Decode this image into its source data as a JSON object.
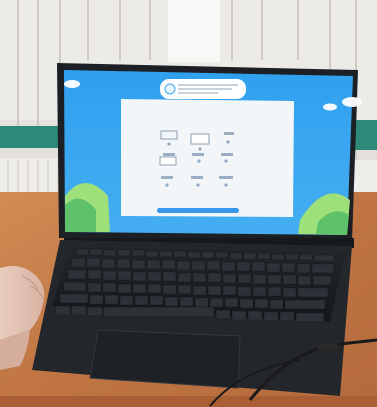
{
  "scene": {
    "subject": "laptop",
    "screen_app": {
      "grid_labels": [
        "",
        "",
        "",
        "",
        "",
        "",
        "",
        "",
        ""
      ]
    },
    "brand_text": ""
  },
  "colors": {
    "sky": "#3fa8ef",
    "card": "#f3f6f8",
    "hill": "#8fd56a",
    "keyboard": "#1b1e23",
    "desk": "#c9814a",
    "wall": "#e8e6e1"
  }
}
